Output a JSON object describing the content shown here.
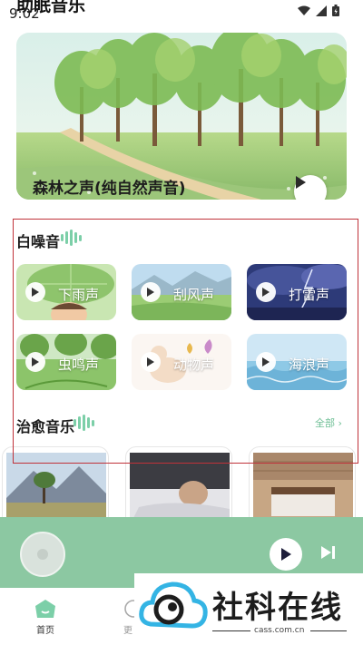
{
  "status_bar": {
    "time": "9:02"
  },
  "page_title": "助眠音乐",
  "hero": {
    "title": "森林之声(纯自然声音)"
  },
  "white_noise": {
    "title": "白噪音",
    "items": [
      {
        "label": "下雨声"
      },
      {
        "label": "刮风声"
      },
      {
        "label": "打雷声"
      },
      {
        "label": "虫鸣声"
      },
      {
        "label": "动物声"
      },
      {
        "label": "海浪声"
      }
    ]
  },
  "healing_music": {
    "title": "治愈音乐",
    "see_all": "全部 ›"
  },
  "tabs": [
    {
      "label": "首页"
    },
    {
      "label": "更"
    }
  ],
  "watermark": {
    "text": "社科在线",
    "domain": "cass.com.cn"
  },
  "colors": {
    "accent": "#7ccfa8",
    "player_bar": "#8cc8a2",
    "selection": "#c0323a"
  }
}
